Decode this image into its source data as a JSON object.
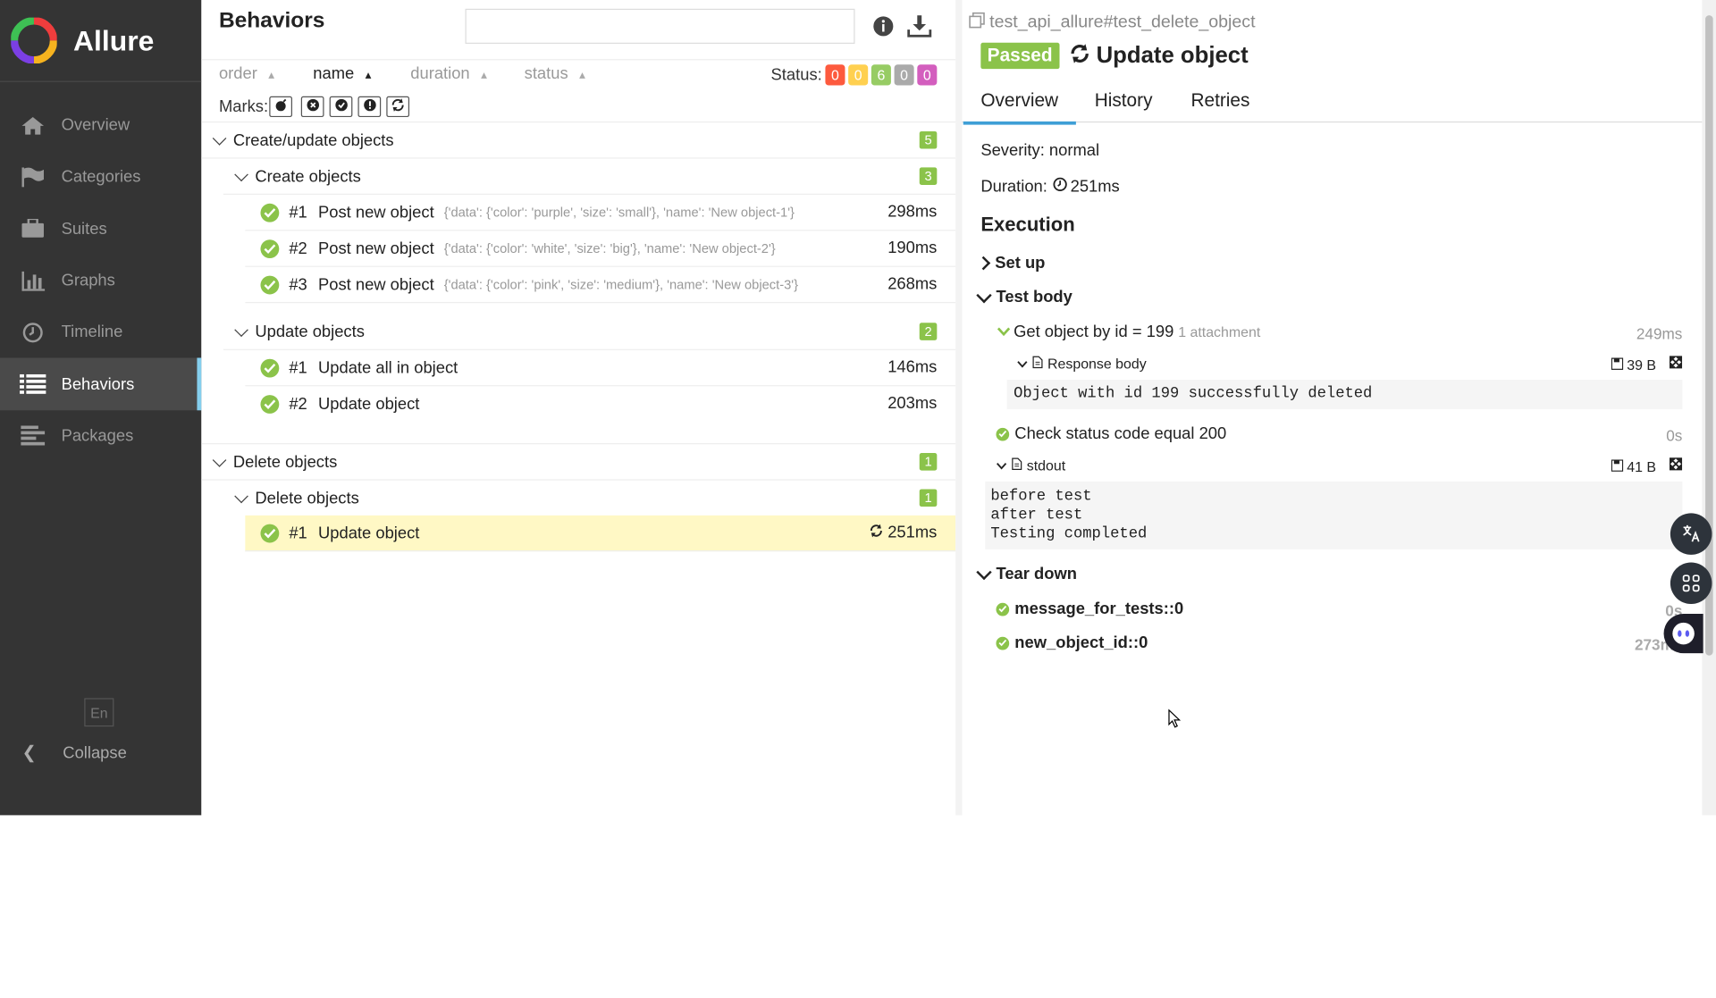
{
  "app": {
    "name": "Allure"
  },
  "sidebar": {
    "items": [
      {
        "label": "Overview",
        "icon": "home-icon"
      },
      {
        "label": "Categories",
        "icon": "flag-icon"
      },
      {
        "label": "Suites",
        "icon": "briefcase-icon"
      },
      {
        "label": "Graphs",
        "icon": "bar-chart-icon"
      },
      {
        "label": "Timeline",
        "icon": "clock-icon"
      },
      {
        "label": "Behaviors",
        "icon": "list-icon",
        "active": true
      },
      {
        "label": "Packages",
        "icon": "align-left-icon"
      }
    ],
    "lang": "En",
    "collapse": "Collapse"
  },
  "tree": {
    "title": "Behaviors",
    "search_value": "",
    "sort": {
      "order": "order",
      "name": "name",
      "duration": "duration",
      "status": "status"
    },
    "status_label": "Status:",
    "status_counts": [
      {
        "value": "0",
        "color": "#fd5a3e"
      },
      {
        "value": "0",
        "color": "#ffd050"
      },
      {
        "value": "6",
        "color": "#97cc64"
      },
      {
        "value": "0",
        "color": "#aaaaaa"
      },
      {
        "value": "0",
        "color": "#d35ebe"
      }
    ],
    "marks_label": "Marks:",
    "groups": [
      {
        "name": "Create/update objects",
        "count": "5",
        "subgroups": [
          {
            "name": "Create objects",
            "count": "3",
            "tests": [
              {
                "num": "#1",
                "name": "Post new object",
                "params": "{'data': {'color': 'purple', 'size': 'small'}, 'name': 'New object-1'}",
                "duration": "298ms"
              },
              {
                "num": "#2",
                "name": "Post new object",
                "params": "{'data': {'color': 'white', 'size': 'big'}, 'name': 'New object-2'}",
                "duration": "190ms"
              },
              {
                "num": "#3",
                "name": "Post new object",
                "params": "{'data': {'color': 'pink', 'size': 'medium'}, 'name': 'New object-3'}",
                "duration": "268ms"
              }
            ]
          },
          {
            "name": "Update objects",
            "count": "2",
            "tests": [
              {
                "num": "#1",
                "name": "Update all in object",
                "params": "",
                "duration": "146ms"
              },
              {
                "num": "#2",
                "name": "Update object",
                "params": "",
                "duration": "203ms"
              }
            ]
          }
        ]
      },
      {
        "name": "Delete objects",
        "count": "1",
        "subgroups": [
          {
            "name": "Delete objects",
            "count": "1",
            "tests": [
              {
                "num": "#1",
                "name": "Update object",
                "params": "",
                "duration": "251ms",
                "selected": true
              }
            ]
          }
        ]
      }
    ]
  },
  "detail": {
    "path": "test_api_allure#test_delete_object",
    "status": "Passed",
    "name": "Update object",
    "tabs": [
      "Overview",
      "History",
      "Retries"
    ],
    "severity": "Severity: normal",
    "duration_label": "Duration:",
    "duration": "251ms",
    "execution": "Execution",
    "setup": "Set up",
    "test_body": "Test body",
    "step1": {
      "name": "Get object by id = 199",
      "attach": "1 attachment",
      "duration": "249ms"
    },
    "attachment1": {
      "name": "Response body",
      "size": "39 B",
      "content": "Object with id 199 successfully deleted"
    },
    "step2": {
      "name": "Check status code equal 200",
      "duration": "0s"
    },
    "attachment2": {
      "name": "stdout",
      "size": "41 B",
      "content": "before test\nafter test\nTesting completed"
    },
    "teardown": "Tear down",
    "td1": {
      "name": "message_for_tests::0",
      "duration": "0s"
    },
    "td2": {
      "name": "new_object_id::0",
      "duration": "273ms"
    }
  }
}
